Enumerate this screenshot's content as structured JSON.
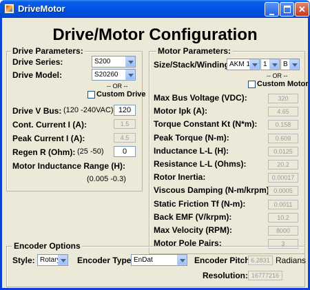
{
  "window": {
    "title": "DriveMotor"
  },
  "heading": "Drive/Motor Configuration",
  "drive": {
    "legend": "Drive Parameters:",
    "series_label": "Drive Series:",
    "series_value": "S200",
    "model_label": "Drive Model:",
    "model_value": "S20260",
    "or_text": "-- OR --",
    "custom_label": "Custom Drive",
    "vbus_label": "Drive V Bus:",
    "vbus_hint": "(120 -240VAC)",
    "vbus_value": "120",
    "cont_label": "Cont. Current I (A):",
    "cont_value": "1.5",
    "peak_label": "Peak Current I (A):",
    "peak_value": "4.5",
    "regen_label": "Regen R (Ohm):",
    "regen_hint": "(25 -50)",
    "regen_value": "0",
    "induct_label": "Motor Inductance Range (H):",
    "induct_range": "(0.005 -0.3)"
  },
  "motor": {
    "legend": "Motor Parameters:",
    "ssw_label": "Size/Stack/Winding:",
    "size_value": "AKM 1",
    "stack_value": "1",
    "winding_value": "B",
    "or_text": "-- OR --",
    "custom_label": "Custom Motor",
    "params": [
      {
        "label": "Max Bus Voltage (VDC):",
        "value": "320"
      },
      {
        "label": "Motor Ipk (A):",
        "value": "4.65"
      },
      {
        "label": "Torque Constant Kt (N*m):",
        "value": "0.158"
      },
      {
        "label": "Peak Torque (N-m):",
        "value": "0.609"
      },
      {
        "label": "Inductance L-L (H):",
        "value": "0.0125"
      },
      {
        "label": "Resistance L-L (Ohms):",
        "value": "20.2"
      },
      {
        "label": "Rotor Inertia:",
        "value": "0.00017"
      },
      {
        "label": "Viscous Damping (N-m/krpm):",
        "value": "0.0005"
      },
      {
        "label": "Static Friction Tf (N-m):",
        "value": "0.0011"
      },
      {
        "label": "Back EMF (V/krpm):",
        "value": "10.2"
      },
      {
        "label": "Max Velocity (RPM):",
        "value": "8000"
      },
      {
        "label": "Motor Pole Pairs:",
        "value": "3"
      }
    ]
  },
  "encoder": {
    "legend": "Encoder Options",
    "style_label": "Style:",
    "style_value": "Rotary",
    "type_label": "Encoder Type:",
    "type_value": "EnDat",
    "pitch_label": "Encoder Pitch:",
    "pitch_value": "6.2831",
    "pitch_unit": "Radians",
    "res_label": "Resolution:",
    "res_value": "16777216"
  }
}
